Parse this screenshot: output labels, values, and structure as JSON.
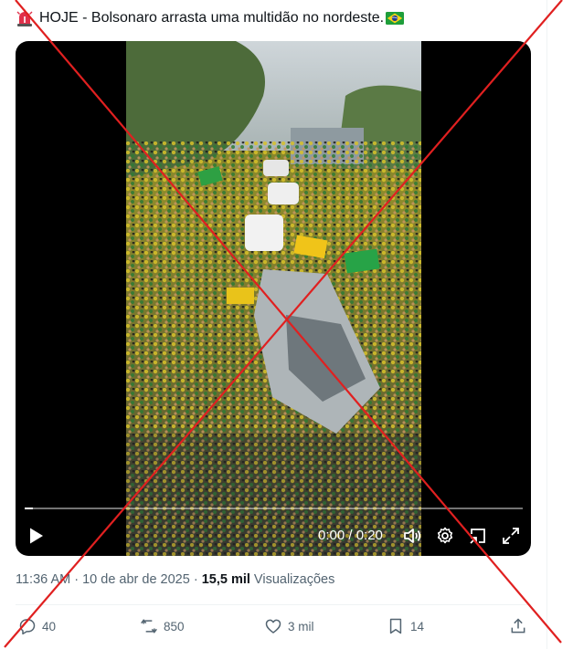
{
  "tweet": {
    "text": "HOJE - Bolsonaro arrasta uma multidão no nordeste.",
    "emoji_prefix": "siren-icon",
    "emoji_suffix": "brazil-flag-icon"
  },
  "video": {
    "time_display": "0:00 / 0:20",
    "progress_fraction": 0.016
  },
  "meta": {
    "time": "11:36 AM",
    "sep1": " · ",
    "date": "10 de abr de 2025",
    "sep2": " · ",
    "views_count": "15,5 mil",
    "views_label": " Visualizações"
  },
  "actions": {
    "replies": "40",
    "reposts": "850",
    "likes": "3 mil",
    "bookmarks": "14"
  },
  "colors": {
    "cross": "#e02020",
    "muted_text": "#536471",
    "text": "#0f1419"
  }
}
